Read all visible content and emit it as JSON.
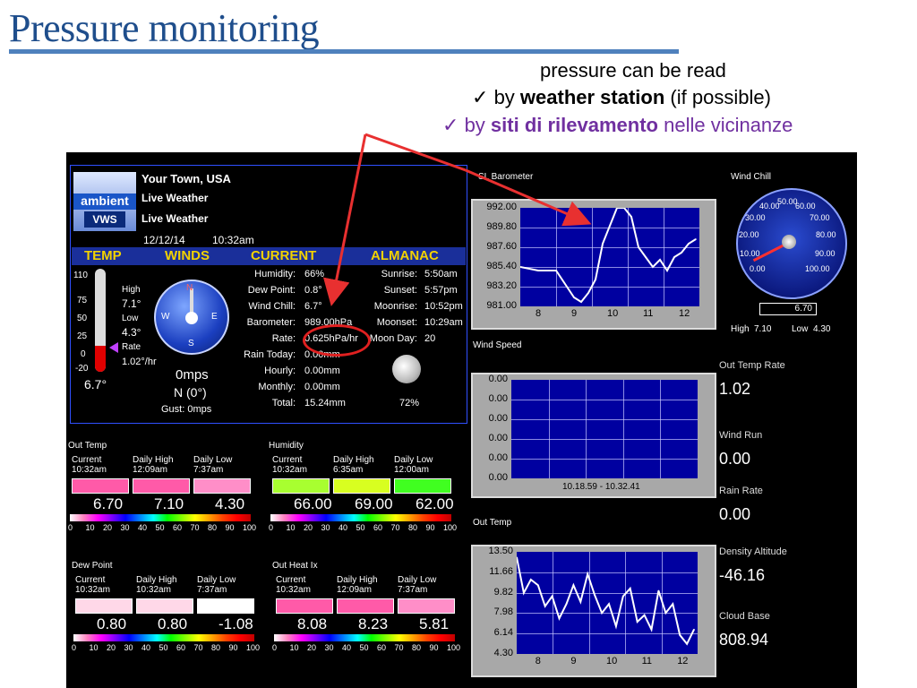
{
  "slide": {
    "title": "Pressure monitoring",
    "line1": "pressure can be read",
    "bullet1_pre": "by ",
    "bullet1_bold": "weather station",
    "bullet1_post": " (if possible)",
    "bullet2_pre": "by ",
    "bullet2_bold": "siti di rilevamento",
    "bullet2_post": " nelle vicinanze",
    "check": "✓"
  },
  "station": {
    "logo_top": "ambient",
    "logo_bottom": "VWS",
    "town": "Your Town, USA",
    "live1": "Live Weather",
    "live2": "Live Weather",
    "date": "12/12/14",
    "time": "10:32am",
    "headers": [
      "TEMP",
      "WINDS",
      "CURRENT",
      "ALMANAC"
    ],
    "thermo": {
      "ticks": [
        "110",
        "75",
        "50",
        "25",
        "0",
        "-20"
      ],
      "reading": "6.7°",
      "high_label": "High",
      "high": "7.1°",
      "low_label": "Low",
      "low": "4.3°",
      "rate_label": "Rate",
      "rate": "1.02°/hr",
      "level_pct": 25
    },
    "wind": {
      "speed": "0mps",
      "dir": "N (0°)",
      "gust": "Gust: 0mps",
      "N": "N",
      "S": "S",
      "E": "E",
      "W": "W"
    },
    "current": [
      {
        "k": "Humidity:",
        "v": "66%"
      },
      {
        "k": "Dew Point:",
        "v": "0.8°"
      },
      {
        "k": "Wind Chill:",
        "v": "6.7°"
      },
      {
        "k": "Barometer:",
        "v": "989.00hPa"
      },
      {
        "k": "Rate:",
        "v": "0.625hPa/hr"
      },
      {
        "k": "Rain Today:",
        "v": "0.00mm"
      },
      {
        "k": "Hourly:",
        "v": "0.00mm"
      },
      {
        "k": "Monthly:",
        "v": "0.00mm"
      },
      {
        "k": "Total:",
        "v": "15.24mm"
      }
    ],
    "almanac": [
      {
        "k": "Sunrise:",
        "v": "5:50am"
      },
      {
        "k": "Sunset:",
        "v": "5:57pm"
      },
      {
        "k": "Moonrise:",
        "v": "10:52pm"
      },
      {
        "k": "Moonset:",
        "v": "10:29am"
      },
      {
        "k": "Moon Day:",
        "v": "20"
      }
    ],
    "moon_pct": "72%"
  },
  "gauges": [
    {
      "title": "Out Temp",
      "labels": [
        [
          "Current",
          "10:32am"
        ],
        [
          "Daily High",
          "12:09am"
        ],
        [
          "Daily Low",
          "7:37am"
        ]
      ],
      "values": [
        "6.70",
        "7.10",
        "4.30"
      ],
      "colors": [
        "#ff5aa8",
        "#ff5aa8",
        "#ff8ec8"
      ]
    },
    {
      "title": "Humidity",
      "labels": [
        [
          "Current",
          "10:32am"
        ],
        [
          "Daily High",
          "6:35am"
        ],
        [
          "Daily Low",
          "12:00am"
        ]
      ],
      "values": [
        "66.00",
        "69.00",
        "62.00"
      ],
      "colors": [
        "#a8ff30",
        "#d8ff20",
        "#40ff20"
      ]
    },
    {
      "title": "Dew Point",
      "labels": [
        [
          "Current",
          "10:32am"
        ],
        [
          "Daily High",
          "10:32am"
        ],
        [
          "Daily Low",
          "7:37am"
        ]
      ],
      "values": [
        "0.80",
        "0.80",
        "-1.08"
      ],
      "colors": [
        "#ffd8e8",
        "#ffd8e8",
        "#ffffff"
      ]
    },
    {
      "title": "Out Heat Ix",
      "labels": [
        [
          "Current",
          "10:32am"
        ],
        [
          "Daily High",
          "12:09am"
        ],
        [
          "Daily Low",
          "7:37am"
        ]
      ],
      "values": [
        "8.08",
        "8.23",
        "5.81"
      ],
      "colors": [
        "#ff5aa8",
        "#ff5aa8",
        "#ff8ec8"
      ]
    }
  ],
  "scale_numbers": [
    "0",
    "10",
    "20",
    "30",
    "40",
    "50",
    "60",
    "70",
    "80",
    "90",
    "100"
  ],
  "charts": {
    "barometer": {
      "title": "SL Barometer",
      "yticks": [
        "992.00",
        "989.80",
        "987.60",
        "985.40",
        "983.20",
        "981.00"
      ],
      "xticks": [
        "8",
        "9",
        "10",
        "11",
        "12"
      ]
    },
    "windspeed": {
      "title": "Wind Speed",
      "yticks": [
        "0.00",
        "0.00",
        "0.00",
        "0.00",
        "0.00",
        "0.00"
      ],
      "range": "10.18.59 - 10.32.41"
    },
    "outtemp": {
      "title": "Out Temp",
      "yticks": [
        "13.50",
        "11.66",
        "9.82",
        "7.98",
        "6.14",
        "4.30"
      ],
      "xticks": [
        "8",
        "9",
        "10",
        "11",
        "12"
      ]
    }
  },
  "chart_data": [
    {
      "type": "line",
      "title": "SL Barometer",
      "ylim": [
        981.0,
        992.0
      ],
      "x": [
        7.5,
        8.0,
        8.5,
        8.8,
        9.0,
        9.2,
        9.4,
        9.6,
        9.8,
        10.0,
        10.2,
        10.4,
        10.6,
        10.8,
        11.0,
        11.2,
        11.4,
        11.6,
        11.8,
        12.0,
        12.2,
        12.4
      ],
      "values": [
        985.4,
        985.0,
        985.0,
        983.2,
        982.0,
        981.5,
        982.5,
        984.0,
        988.0,
        990.0,
        992.0,
        992.0,
        991.0,
        987.6,
        986.5,
        985.4,
        986.2,
        985.0,
        986.5,
        987.0,
        988.0,
        988.5
      ]
    },
    {
      "type": "line",
      "title": "Wind Speed",
      "ylim": [
        0,
        0
      ],
      "values": []
    },
    {
      "type": "line",
      "title": "Out Temp",
      "ylim": [
        4.3,
        13.5
      ],
      "x": [
        7.4,
        7.6,
        7.8,
        8.0,
        8.2,
        8.4,
        8.6,
        8.8,
        9.0,
        9.2,
        9.4,
        9.6,
        9.8,
        10.0,
        10.2,
        10.4,
        10.6,
        10.8,
        11.0,
        11.2,
        11.4,
        11.6,
        11.8,
        12.0,
        12.2,
        12.4
      ],
      "values": [
        13.0,
        9.8,
        11.0,
        10.5,
        8.6,
        9.5,
        7.5,
        8.8,
        10.5,
        9.0,
        11.5,
        9.6,
        8.0,
        8.8,
        6.8,
        9.5,
        10.2,
        7.2,
        7.8,
        6.5,
        10.0,
        8.0,
        8.8,
        6.0,
        5.2,
        6.5
      ]
    }
  ],
  "windchill": {
    "title": "Wind Chill",
    "ticks": [
      "0.00",
      "10.00",
      "20.00",
      "30.00",
      "40.00",
      "50.00",
      "60.00",
      "70.00",
      "80.00",
      "90.00",
      "100.00"
    ],
    "readout": "6.70",
    "high_label": "High",
    "high": "7.10",
    "low_label": "Low",
    "low": "4.30",
    "value": 6.7
  },
  "right": [
    {
      "label": "Out Temp Rate",
      "value": "1.02"
    },
    {
      "label": "Wind Run",
      "value": "0.00"
    },
    {
      "label": "Rain Rate",
      "value": "0.00"
    },
    {
      "label": "Density Altitude",
      "value": "-46.16"
    },
    {
      "label": "Cloud Base",
      "value": "808.94"
    }
  ]
}
